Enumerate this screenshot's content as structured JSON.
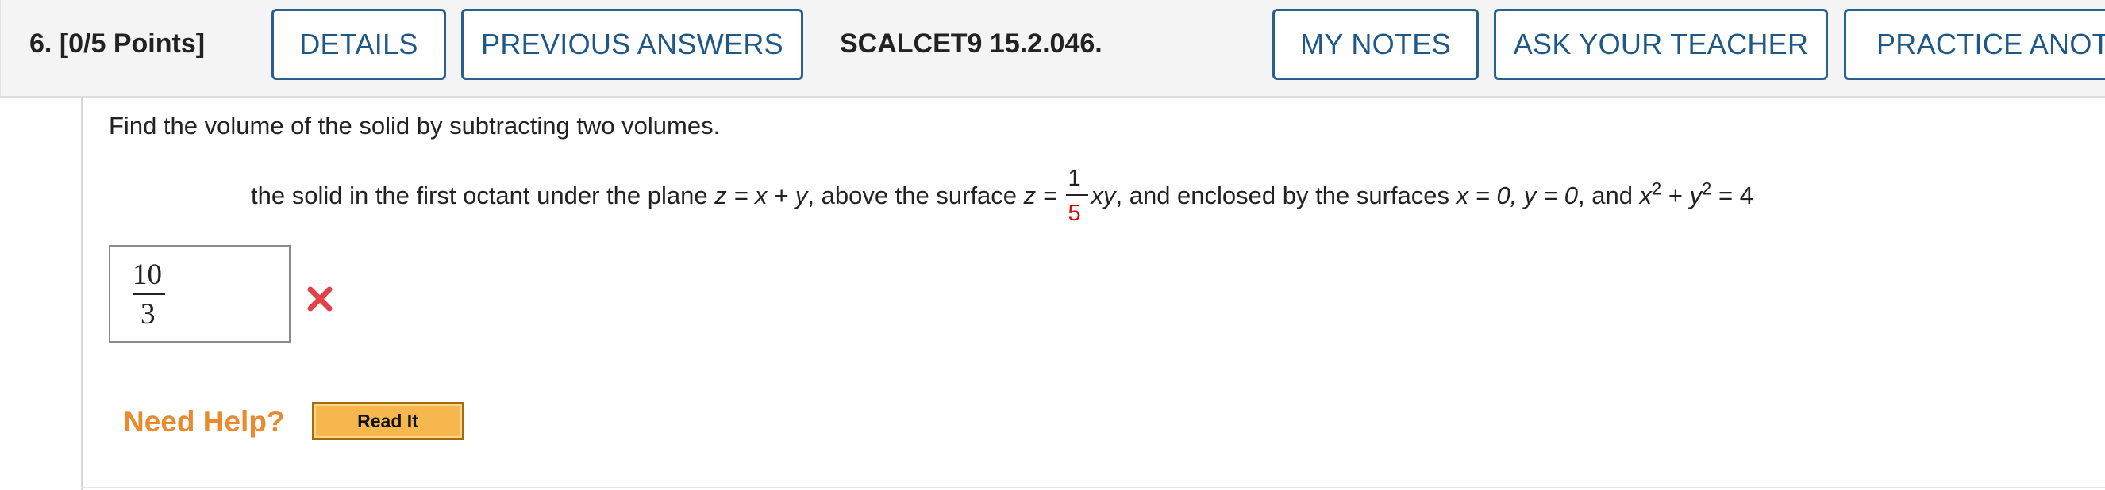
{
  "header": {
    "question_number": "6.",
    "points": "[0/5 Points]",
    "buttons": {
      "details": "DETAILS",
      "previous_answers": "PREVIOUS ANSWERS",
      "my_notes": "MY NOTES",
      "ask_teacher": "ASK YOUR TEACHER",
      "practice_another": "PRACTICE ANOTHER"
    },
    "question_code": "SCALCET9 15.2.046."
  },
  "question": {
    "prompt": "Find the volume of the solid by subtracting two volumes.",
    "problem": {
      "part1": "the solid in the first octant under the plane ",
      "eq1": "z = x + y",
      "part2": ", above the surface ",
      "eq2_lhs": "z = ",
      "frac_num": "1",
      "frac_den": "5",
      "eq2_rhs": "xy",
      "part3": ", and enclosed by the surfaces ",
      "eq3": "x = 0, y = 0",
      "part4": ", and ",
      "eq4_x": "x",
      "eq4_exp1": "2",
      "eq4_plus": " + ",
      "eq4_y": "y",
      "eq4_exp2": "2",
      "eq4_rhs": " = 4"
    }
  },
  "answer": {
    "numerator": "10",
    "denominator": "3",
    "status": "incorrect",
    "status_icon": "x-mark-icon"
  },
  "help": {
    "label": "Need Help?",
    "read_it": "Read It"
  },
  "colors": {
    "button_border": "#2a5f8f",
    "button_text": "#1f5787",
    "incorrect": "#e0424b",
    "need_help": "#e88a2e",
    "fraction_denominator": "#cc1111"
  }
}
